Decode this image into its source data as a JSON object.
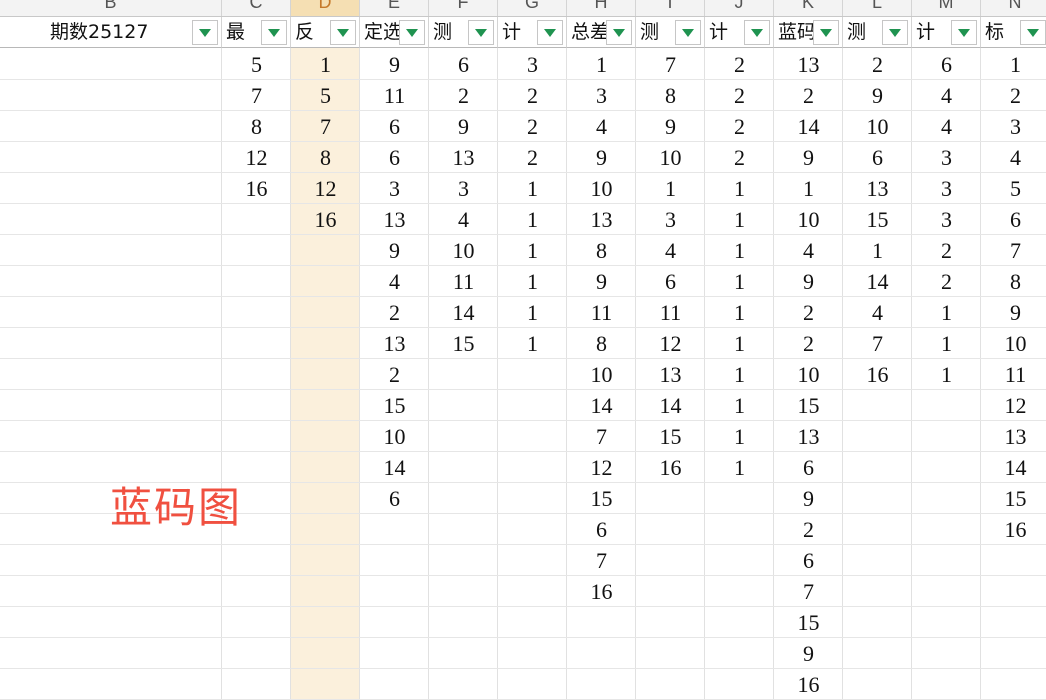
{
  "column_letters": [
    "B",
    "C",
    "D",
    "E",
    "F",
    "G",
    "H",
    "I",
    "J",
    "K",
    "L",
    "M",
    "N"
  ],
  "selected_column": "D",
  "filter_headers": [
    "期数25127",
    "最",
    "反",
    "定选",
    "测",
    "计",
    "总差",
    "测",
    "计",
    "蓝码",
    "测",
    "计",
    "标"
  ],
  "columns": [
    [],
    [
      "5",
      "7",
      "8",
      "12",
      "16"
    ],
    [
      "1",
      "5",
      "7",
      "8",
      "12",
      "16"
    ],
    [
      "9",
      "11",
      "6",
      "6",
      "3",
      "13",
      "9",
      "4",
      "2",
      "13",
      "2",
      "15",
      "10",
      "14",
      "6"
    ],
    [
      "6",
      "2",
      "9",
      "13",
      "3",
      "4",
      "10",
      "11",
      "14",
      "15"
    ],
    [
      "3",
      "2",
      "2",
      "2",
      "1",
      "1",
      "1",
      "1",
      "1",
      "1"
    ],
    [
      "1",
      "3",
      "4",
      "9",
      "10",
      "13",
      "8",
      "9",
      "11",
      "8",
      "10",
      "14",
      "7",
      "12",
      "15",
      "6",
      "7",
      "16"
    ],
    [
      "7",
      "8",
      "9",
      "10",
      "1",
      "3",
      "4",
      "6",
      "11",
      "12",
      "13",
      "14",
      "15",
      "16"
    ],
    [
      "2",
      "2",
      "2",
      "2",
      "1",
      "1",
      "1",
      "1",
      "1",
      "1",
      "1",
      "1",
      "1",
      "1"
    ],
    [
      "13",
      "2",
      "14",
      "9",
      "1",
      "10",
      "4",
      "9",
      "2",
      "2",
      "10",
      "15",
      "13",
      "6",
      "9",
      "2",
      "6",
      "7",
      "15",
      "9",
      "16"
    ],
    [
      "2",
      "9",
      "10",
      "6",
      "13",
      "15",
      "1",
      "14",
      "4",
      "7",
      "16"
    ],
    [
      "6",
      "4",
      "4",
      "3",
      "3",
      "3",
      "2",
      "2",
      "1",
      "1",
      "1"
    ],
    [
      "1",
      "2",
      "3",
      "4",
      "5",
      "6",
      "7",
      "8",
      "9",
      "10",
      "11",
      "12",
      "13",
      "14",
      "15",
      "16"
    ]
  ],
  "overlay_label": "蓝码图",
  "colors": {
    "filter_arrow": "#1f9350",
    "selected_column_band": "#fbf0dc",
    "selected_header": "#f5dfb3",
    "overlay_text": "#f05040"
  }
}
